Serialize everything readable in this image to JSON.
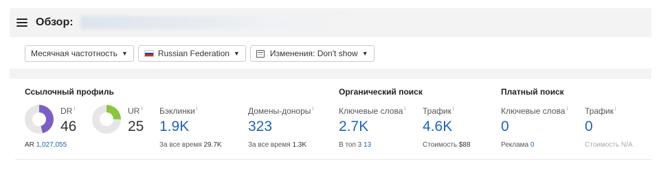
{
  "header": {
    "title": "Обзор:"
  },
  "filters": {
    "frequency": "Месячная частотность",
    "country": "Russian Federation",
    "changes": "Изменения: Don't show"
  },
  "backlink_profile": {
    "title": "Ссылочный профиль",
    "dr": {
      "label": "DR",
      "value": "46",
      "fraction": 0.46
    },
    "ur": {
      "label": "UR",
      "value": "25",
      "fraction": 0.25
    },
    "ar": {
      "label": "AR",
      "value": "1,027,055"
    },
    "backlinks": {
      "label": "Бэклинки",
      "value": "1.9K",
      "sub_label": "За все время",
      "sub_value": "29.7K"
    },
    "ref_domains": {
      "label": "Домены-доноры",
      "value": "323",
      "sub_label": "За все время",
      "sub_value": "1.3K"
    }
  },
  "organic": {
    "title": "Органический поиск",
    "keywords": {
      "label": "Ключевые слова",
      "value": "2.7K",
      "sub_label": "В топ 3",
      "sub_value": "13"
    },
    "traffic": {
      "label": "Трафик",
      "value": "4.6K",
      "sub_label": "Стоимость",
      "sub_value": "$88"
    }
  },
  "paid": {
    "title": "Платный поиск",
    "keywords": {
      "label": "Ключевые слова",
      "value": "0",
      "sub_label": "Реклама",
      "sub_value": "0"
    },
    "traffic": {
      "label": "Трафик",
      "value": "0",
      "sub_label": "Стоимость",
      "sub_value": "N/A"
    }
  },
  "icons": {
    "menu": "hamburger-menu-icon",
    "dropdown": "caret-down-icon",
    "flag": "russia-flag-icon",
    "calendar": "calendar-icon",
    "info": "info-icon"
  },
  "colors": {
    "dr_donut": "#7b5fc4",
    "ur_donut": "#8cc63f",
    "donut_track": "#e6e6e6",
    "link_blue": "#1f63b3"
  }
}
